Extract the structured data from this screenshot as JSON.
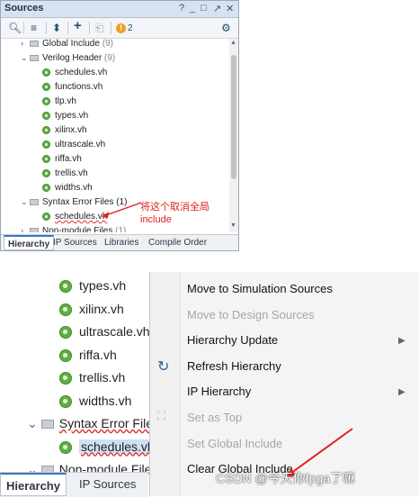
{
  "top_panel": {
    "title": "Sources",
    "window_controls": [
      "?",
      "_",
      "□",
      "↗",
      "✕"
    ],
    "toolbar": {
      "warning_count": "2"
    },
    "rows": [
      {
        "indent": 1,
        "type": "folder",
        "arrow": "›",
        "label": "Global Include",
        "count": "(9)"
      },
      {
        "indent": 1,
        "type": "folder",
        "arrow": "⌄",
        "label": "Verilog Header",
        "count": "(9)"
      },
      {
        "indent": 2,
        "type": "file",
        "label": "schedules.vh"
      },
      {
        "indent": 2,
        "type": "file",
        "label": "functions.vh"
      },
      {
        "indent": 2,
        "type": "file",
        "label": "tlp.vh"
      },
      {
        "indent": 2,
        "type": "file",
        "label": "types.vh"
      },
      {
        "indent": 2,
        "type": "file",
        "label": "xilinx.vh"
      },
      {
        "indent": 2,
        "type": "file",
        "label": "ultrascale.vh"
      },
      {
        "indent": 2,
        "type": "file",
        "label": "riffa.vh"
      },
      {
        "indent": 2,
        "type": "file",
        "label": "trellis.vh"
      },
      {
        "indent": 2,
        "type": "file",
        "label": "widths.vh"
      },
      {
        "indent": 1,
        "type": "folder",
        "arrow": "⌄",
        "label": "Syntax Error Files (1)",
        "count": ""
      },
      {
        "indent": 2,
        "type": "file",
        "label": "schedules.vh",
        "selected": true
      },
      {
        "indent": 1,
        "type": "folder",
        "arrow": "›",
        "label": "Non-module Files",
        "count": "(1)"
      }
    ],
    "tabs": [
      "Hierarchy",
      "IP Sources",
      "Libraries",
      "Compile Order"
    ],
    "annotation": "将这个取消全局\ninclude"
  },
  "bottom_panel": {
    "rows": [
      {
        "type": "file",
        "label": "types.vh"
      },
      {
        "type": "file",
        "label": "xilinx.vh"
      },
      {
        "type": "file",
        "label": "ultrascale.vh"
      },
      {
        "type": "file",
        "label": "riffa.vh"
      },
      {
        "type": "file",
        "label": "trellis.vh"
      },
      {
        "type": "file",
        "label": "widths.vh"
      },
      {
        "type": "folder",
        "label": "Syntax Error Files"
      },
      {
        "type": "file",
        "label": "schedules.vh",
        "selected": true
      },
      {
        "type": "folder",
        "label": "Non-module File"
      }
    ],
    "tabs": [
      "Hierarchy",
      "IP Sources"
    ],
    "menu": [
      {
        "label": "Move to Simulation Sources",
        "enabled": true
      },
      {
        "label": "Move to Design Sources",
        "enabled": false
      },
      {
        "label": "Hierarchy Update",
        "enabled": true,
        "submenu": true
      },
      {
        "label": "Refresh Hierarchy",
        "enabled": true,
        "icon": "refresh-icon"
      },
      {
        "label": "IP Hierarchy",
        "enabled": true,
        "submenu": true
      },
      {
        "label": "Set as Top",
        "enabled": false,
        "icon": "hierarchy-icon"
      },
      {
        "label": "Set Global Include",
        "enabled": false
      },
      {
        "label": "Clear Global Include",
        "enabled": true
      }
    ],
    "watermark": "CSDN @今天你fpga了嘛"
  }
}
